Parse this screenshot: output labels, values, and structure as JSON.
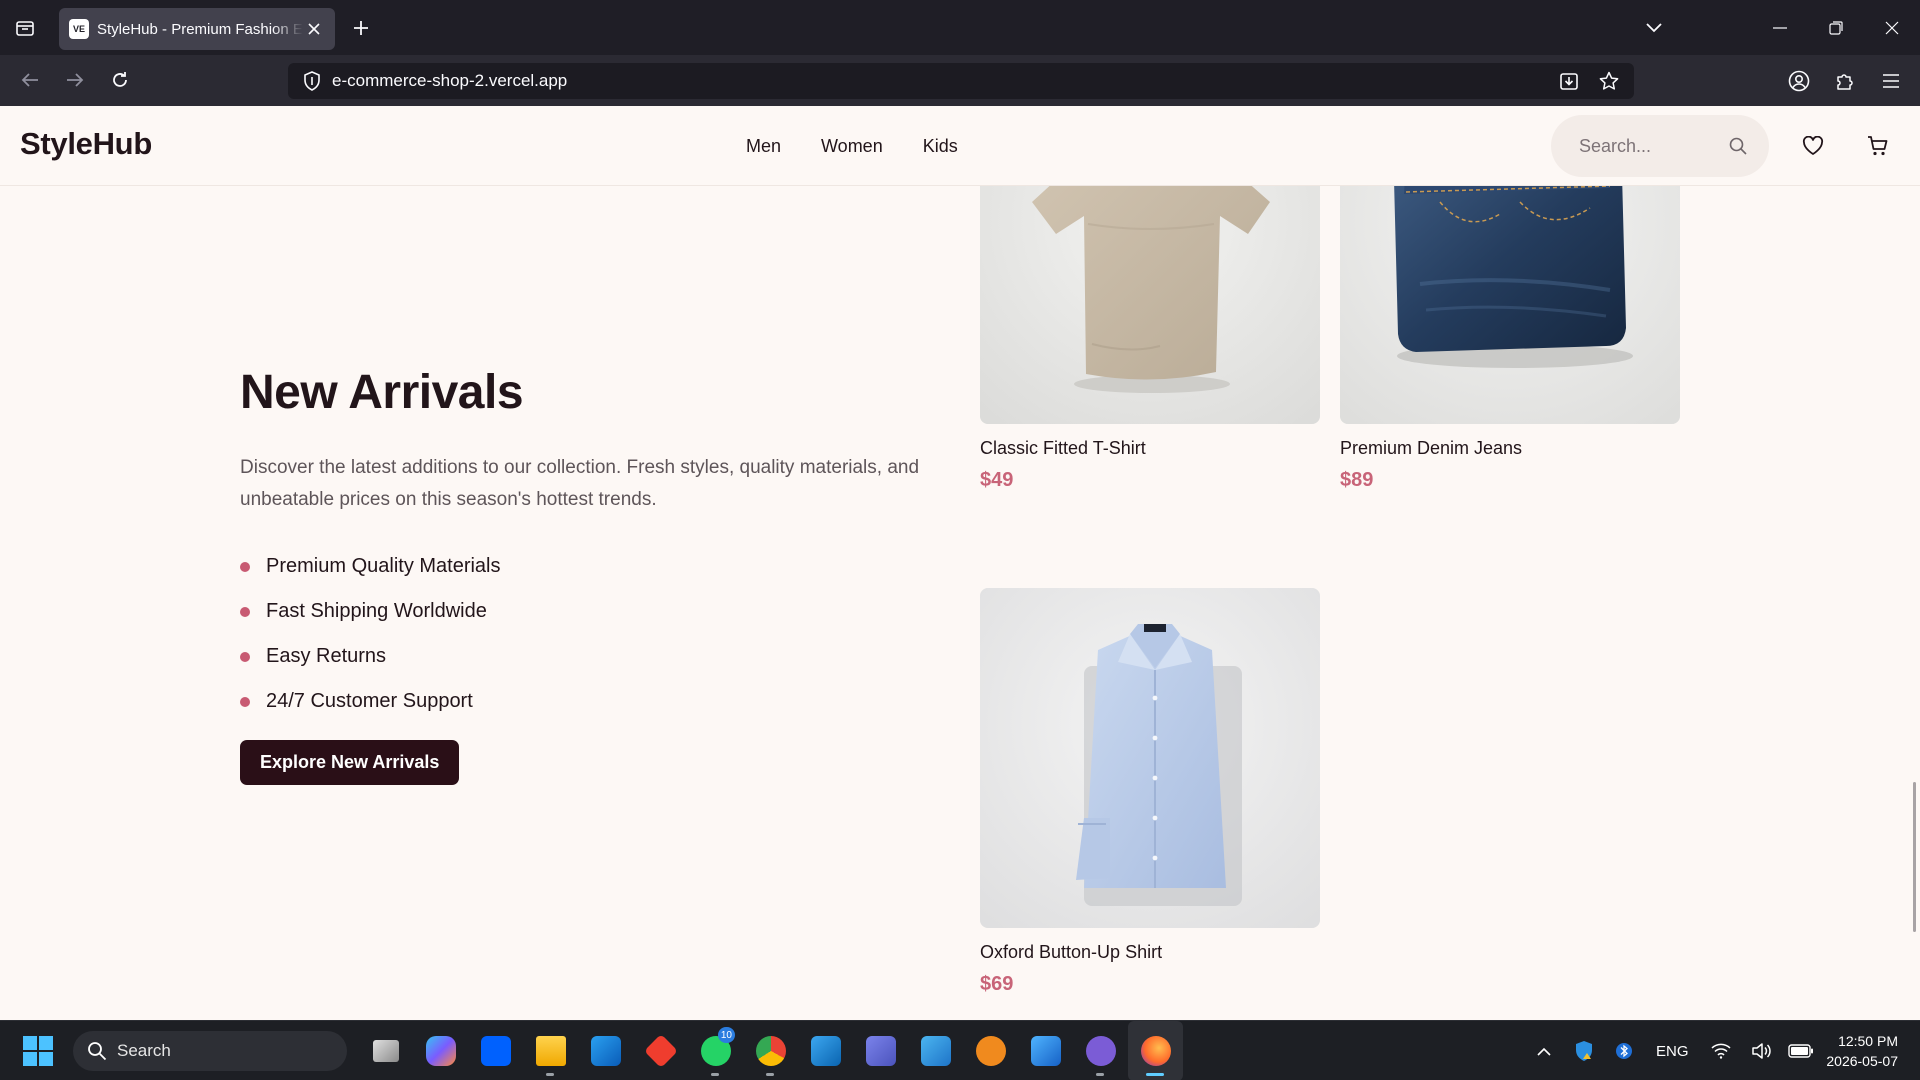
{
  "browser": {
    "tab_title": "StyleHub - Premium Fashion E-commerce",
    "favicon_text": "VE",
    "url": "e-commerce-shop-2.vercel.app"
  },
  "site": {
    "logo": "StyleHub",
    "nav": [
      "Men",
      "Women",
      "Kids"
    ],
    "search_placeholder": "Search..."
  },
  "section": {
    "title": "New Arrivals",
    "description": "Discover the latest additions to our collection. Fresh styles, quality materials, and unbeatable prices on this season's hottest trends.",
    "features": [
      "Premium Quality Materials",
      "Fast Shipping Worldwide",
      "Easy Returns",
      "24/7 Customer Support"
    ],
    "cta_label": "Explore New Arrivals"
  },
  "products": [
    {
      "name": "Classic Fitted T-Shirt",
      "price": "$49",
      "image": "beige-tshirt-image"
    },
    {
      "name": "Premium Denim Jeans",
      "price": "$89",
      "image": "folded-jeans-image"
    },
    {
      "name": "Oxford Button-Up Shirt",
      "price": "$69",
      "image": "blue-shirt-image"
    }
  ],
  "taskbar": {
    "search_label": "Search",
    "whatsapp_badge": "10",
    "language": "ENG",
    "time": "12:50 PM",
    "date": "2026-05-07"
  },
  "colors": {
    "accent": "#c85a72",
    "button": "#2a0f17",
    "price": "#c86478",
    "background": "#fdf8f5"
  }
}
